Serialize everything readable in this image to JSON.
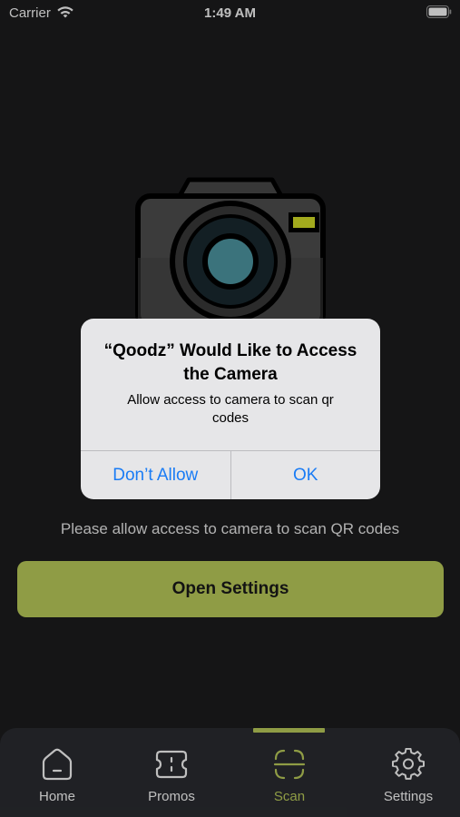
{
  "status_bar": {
    "carrier": "Carrier",
    "time": "1:49 AM"
  },
  "permission_screen": {
    "message": "Please allow access to camera to scan QR codes",
    "open_settings_label": "Open Settings"
  },
  "alert": {
    "title": "“Qoodz” Would Like to Access the Camera",
    "message": "Allow access to camera to scan qr codes",
    "deny_label": "Don’t Allow",
    "allow_label": "OK"
  },
  "tab_bar": {
    "active_tab": "Scan",
    "tabs": [
      {
        "label": "Home",
        "icon": "home-icon"
      },
      {
        "label": "Promos",
        "icon": "ticket-icon"
      },
      {
        "label": "Scan",
        "icon": "scan-icon"
      },
      {
        "label": "Settings",
        "icon": "gear-icon"
      }
    ]
  },
  "colors": {
    "background": "#1c1c1e",
    "accent": "#bfd15d",
    "tab_bar": "#2b2d32",
    "alert_button": "#1a7cf5"
  }
}
